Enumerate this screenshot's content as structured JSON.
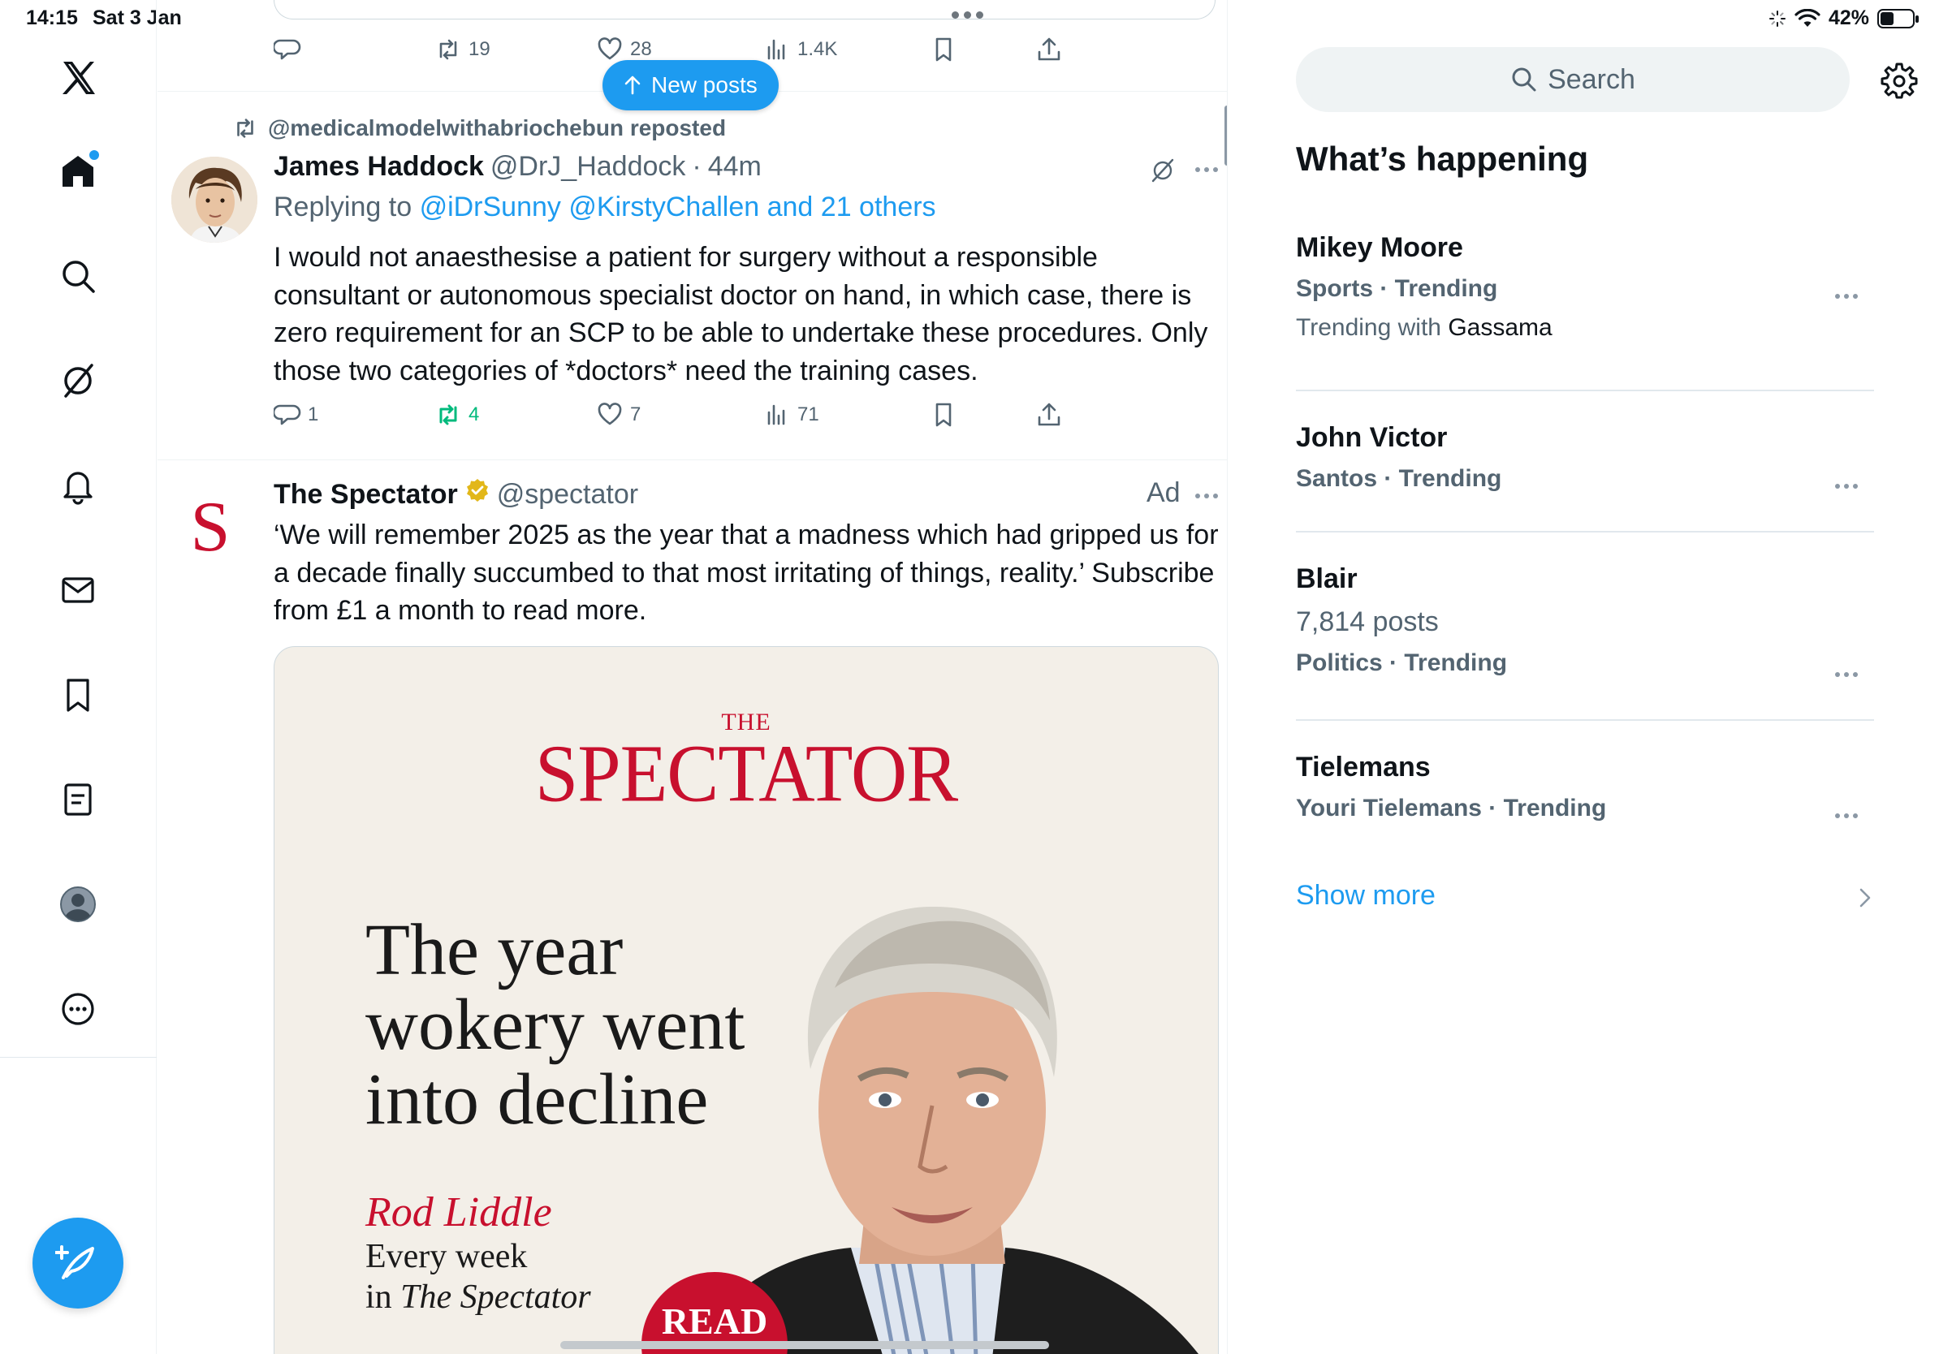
{
  "status_bar": {
    "time": "14:15",
    "date": "Sat 3 Jan",
    "battery": "42%"
  },
  "nav": {
    "items": [
      "x-logo",
      "home",
      "search",
      "grok",
      "notifications",
      "messages",
      "bookmarks",
      "lists",
      "profile",
      "more"
    ],
    "accent": "#1d9bf0"
  },
  "timeline": {
    "prev_tweet_actions": {
      "reply": "",
      "retweet": "19",
      "like": "28",
      "views": "1.4K"
    },
    "new_posts_label": "New posts",
    "reposted_tweet": {
      "repost_context": "@medicalmodelwithabriochebun reposted",
      "name": "James Haddock",
      "handle": "@DrJ_Haddock",
      "separator": "·",
      "time": "44m",
      "replying_prefix": "Replying to",
      "replying_targets": "@iDrSunny @KirstyChallen and 21 others",
      "text": "I would not anaesthesise a patient for surgery without a responsible consultant or autonomous specialist doctor on hand, in which case, there is zero requirement for an SCP to be able to undertake these procedures. Only those two categories of *doctors* need the training cases.",
      "actions": {
        "reply": "1",
        "retweet": "4",
        "like": "7",
        "views": "71"
      }
    },
    "ad_tweet": {
      "avatar_letter": "S",
      "name": "The Spectator",
      "handle": "@spectator",
      "ad_label": "Ad",
      "text": "‘We will remember 2025 as the year that a madness which had gripped us for a decade finally succumbed to that most irritating of things, reality.’ Subscribe from £1 a month to read more.",
      "card": {
        "masthead_the": "THE",
        "masthead_name": "SPECTATOR",
        "headline": [
          "The year",
          "wokery went",
          "into decline"
        ],
        "author": "Rod Liddle",
        "byline_1": "Every week",
        "byline_2_prefix": "in ",
        "byline_2_italic": "The Spectator",
        "badge": "READ",
        "brand_color": "#c8102e"
      }
    }
  },
  "sidebar": {
    "search_placeholder": "Search",
    "section_title": "What’s happening",
    "trends": [
      {
        "name": "Mikey Moore",
        "meta": "Sports · Trending",
        "sub_prefix": "Trending with ",
        "sub_value": "Gassama"
      },
      {
        "name": "John Victor",
        "meta": "Santos · Trending"
      },
      {
        "name": "Blair",
        "count": "7,814 posts",
        "meta": "Politics · Trending"
      },
      {
        "name": "Tielemans",
        "meta": "Youri Tielemans · Trending"
      }
    ],
    "show_more": "Show more"
  }
}
